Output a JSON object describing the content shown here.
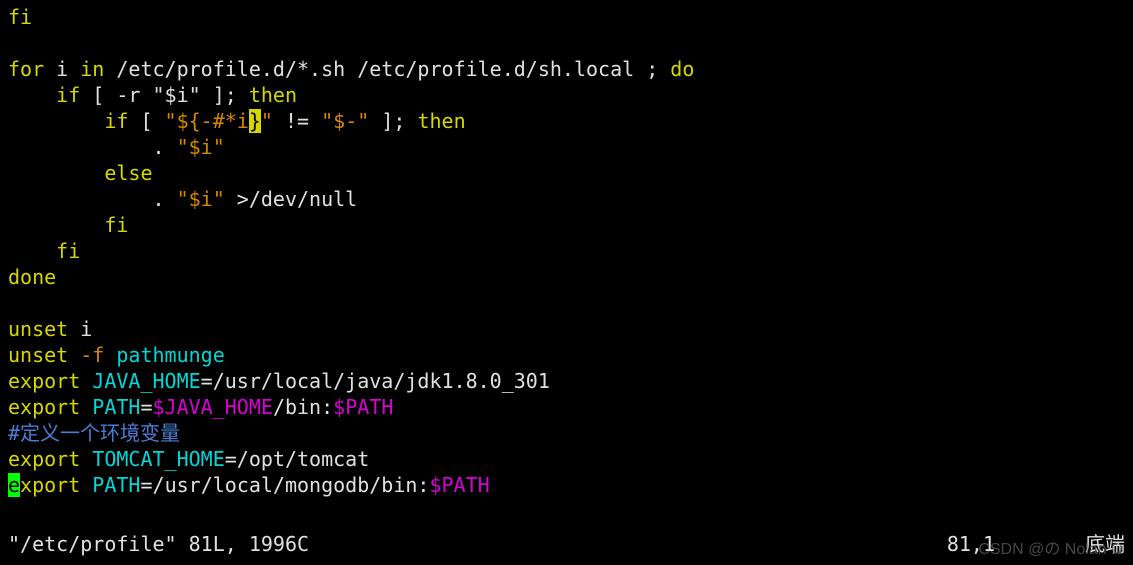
{
  "lines": {
    "l1": "fi",
    "l2_for": "for",
    "l2_i": " i ",
    "l2_in": "in",
    "l2_path": " /etc/profile.d/*.sh /etc/profile.d/sh.local ; ",
    "l2_do": "do",
    "l3_if": "    if",
    "l3_cond": " [ -r \"$i\" ]; ",
    "l3_then": "then",
    "l4_if": "        if",
    "l4_a": " [ ",
    "l4_b": "\"${-#*i",
    "l4_cursor": "}",
    "l4_c": "\"",
    "l4_d": " != ",
    "l4_e": "\"$-\"",
    "l4_f": " ]; ",
    "l4_then": "then",
    "l5_a": "            . ",
    "l5_b": "\"$i\"",
    "l6": "        else",
    "l7_a": "            . ",
    "l7_b": "\"$i\"",
    "l7_c": " >/dev/null",
    "l8": "        fi",
    "l9": "    fi",
    "l10": "done",
    "l11": " ",
    "l12_a": "unset",
    "l12_b": " i",
    "l13_a": "unset",
    "l13_b": " -f",
    "l13_c": " pathmunge",
    "l14_a": "export",
    "l14_b": " JAVA_HOME",
    "l14_c": "=/usr/local/java/jdk1.8.0_301",
    "l15_a": "export",
    "l15_b": " PATH",
    "l15_c": "=",
    "l15_d": "$JAVA_HOME",
    "l15_e": "/bin:",
    "l15_f": "$PATH",
    "l16": "#定义一个环境变量",
    "l17_a": "export",
    "l17_b": " TOMCAT_HOME",
    "l17_c": "=/opt/tomcat",
    "l18_cursor": "e",
    "l18_a": "xport",
    "l18_b": " PATH",
    "l18_c": "=/usr/local/mongodb/bin:",
    "l18_d": "$PATH"
  },
  "status": {
    "file": "\"/etc/profile\" 81L, 1996C",
    "pos": "81,1",
    "loc": "底端"
  },
  "watermark": "CSDN @の Nolan Ω"
}
